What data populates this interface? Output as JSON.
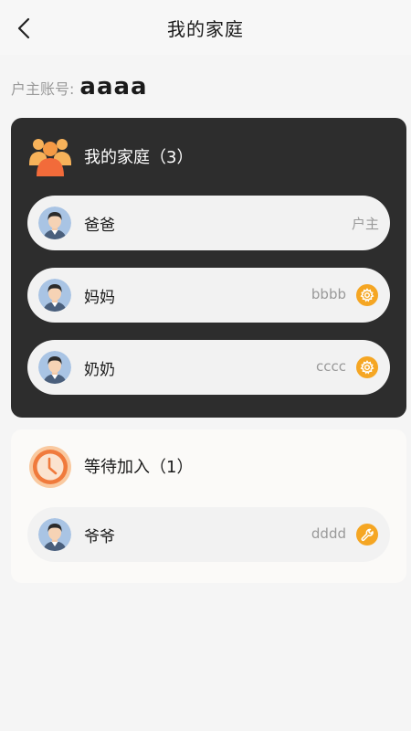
{
  "header": {
    "title": "我的家庭"
  },
  "owner": {
    "label": "户主账号:",
    "value": "aaaa"
  },
  "family": {
    "title": "我的家庭（3）",
    "members": [
      {
        "name": "爸爸",
        "role": "户主"
      },
      {
        "name": "妈妈",
        "account": "bbbb"
      },
      {
        "name": "奶奶",
        "account": "cccc"
      }
    ]
  },
  "pending": {
    "title": "等待加入（1）",
    "members": [
      {
        "name": "爷爷",
        "account": "dddd"
      }
    ]
  },
  "colors": {
    "accent": "#f5a623",
    "family_icon": "#f5a04a",
    "dark_card": "#2d2d2d"
  },
  "icons": {
    "back": "chevron-left-icon",
    "family": "family-group-icon",
    "pending": "clock-icon",
    "settings": "gear-icon",
    "edit": "wrench-icon"
  }
}
